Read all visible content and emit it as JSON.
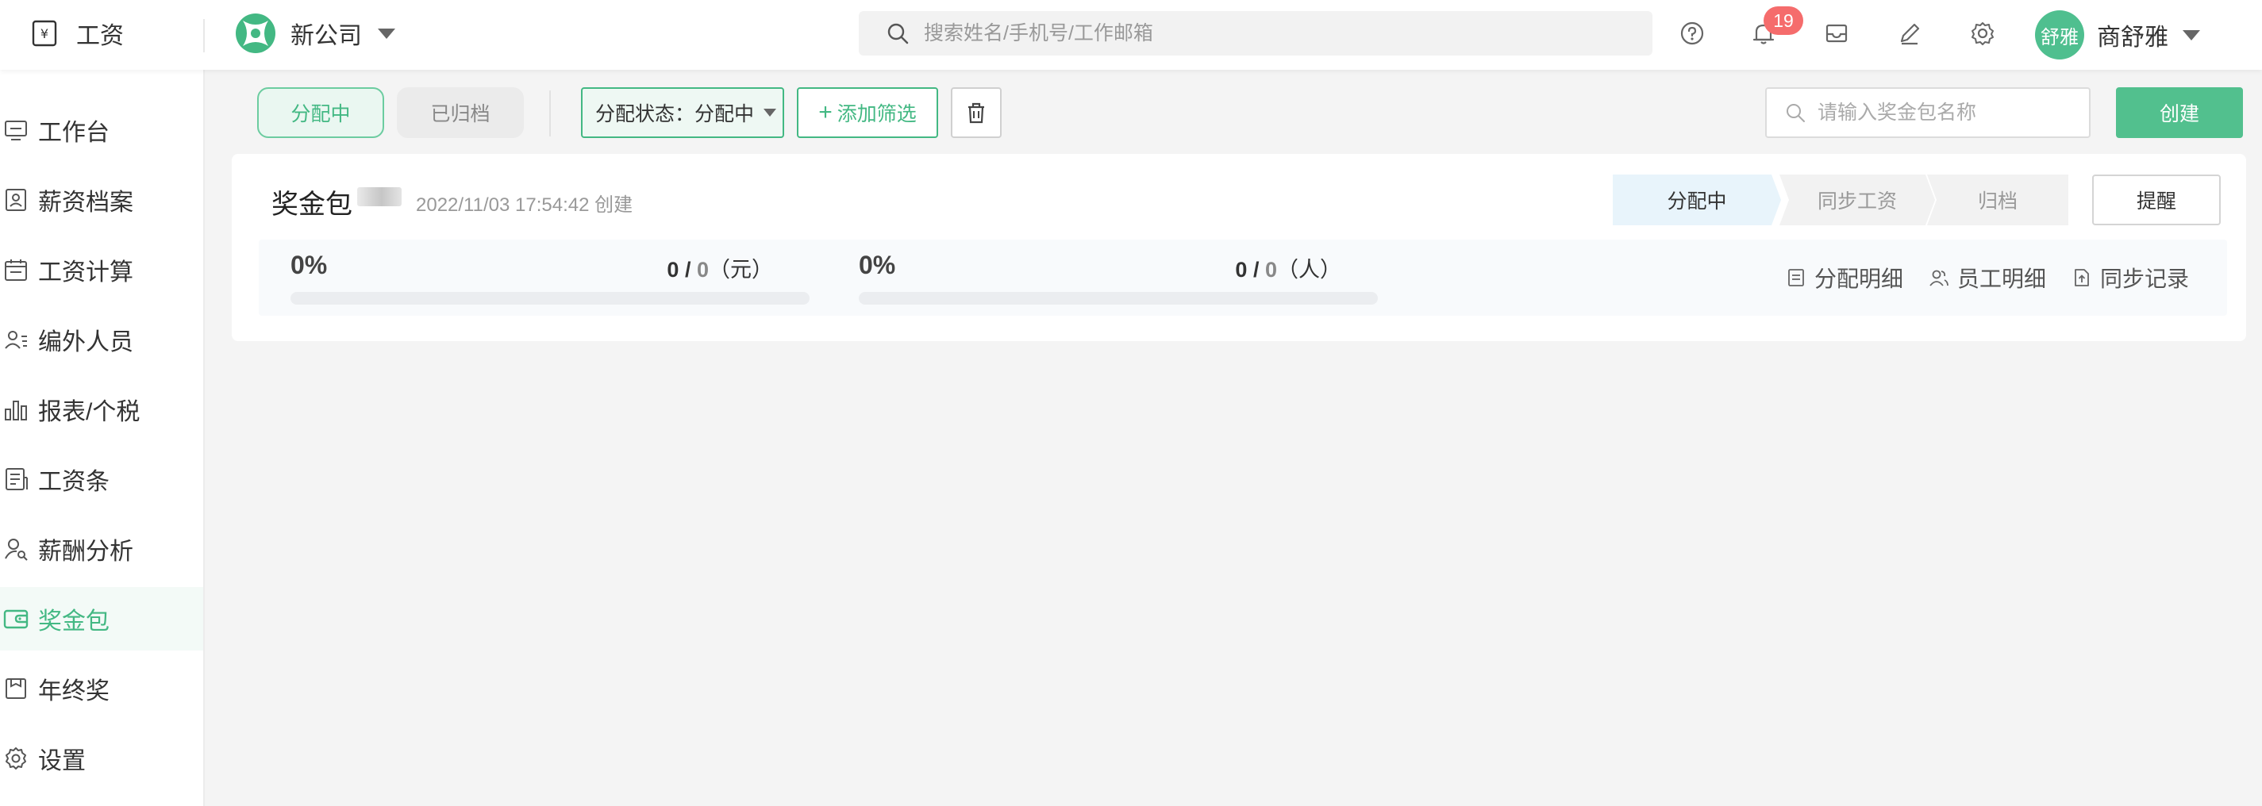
{
  "header": {
    "app_title": "工资",
    "company_name": "新公司",
    "search_placeholder": "搜索姓名/手机号/工作邮箱",
    "notification_count": "19",
    "user_avatar_text": "舒雅",
    "user_name": "商舒雅"
  },
  "sidebar": {
    "items": [
      {
        "label": "工作台",
        "icon": "monitor-icon"
      },
      {
        "label": "薪资档案",
        "icon": "profile-card-icon"
      },
      {
        "label": "工资计算",
        "icon": "calendar-icon"
      },
      {
        "label": "编外人员",
        "icon": "user-list-icon"
      },
      {
        "label": "报表/个税",
        "icon": "bar-chart-icon"
      },
      {
        "label": "工资条",
        "icon": "document-icon"
      },
      {
        "label": "薪酬分析",
        "icon": "user-search-icon"
      },
      {
        "label": "奖金包",
        "icon": "wallet-icon",
        "active": true
      },
      {
        "label": "年终奖",
        "icon": "gift-box-icon"
      },
      {
        "label": "设置",
        "icon": "gear-icon"
      }
    ]
  },
  "toolbar": {
    "tab_active": "分配中",
    "tab_archived": "已归档",
    "filter_label": "分配状态：分配中",
    "add_filter_label": "添加筛选",
    "package_search_placeholder": "请输入奖金包名称",
    "create_label": "创建"
  },
  "card": {
    "title": "奖金包",
    "meta": "2022/11/03 17:54:42 创建",
    "steps": [
      "分配中",
      "同步工资",
      "归档"
    ],
    "remind_label": "提醒",
    "amount": {
      "percent": "0%",
      "allocated": "0",
      "separator": "/",
      "total": "0",
      "unit": "（元）",
      "progress": 0
    },
    "people": {
      "percent": "0%",
      "allocated": "0",
      "separator": "/",
      "total": "0",
      "unit": "（人）",
      "progress": 0
    },
    "links": {
      "allocation_detail": "分配明细",
      "employee_detail": "员工明细",
      "sync_record": "同步记录"
    }
  },
  "colors": {
    "accent": "#43b883",
    "primary_button": "#52c08e",
    "badge": "#f56c6c",
    "active_step": "#e8f4fb"
  }
}
